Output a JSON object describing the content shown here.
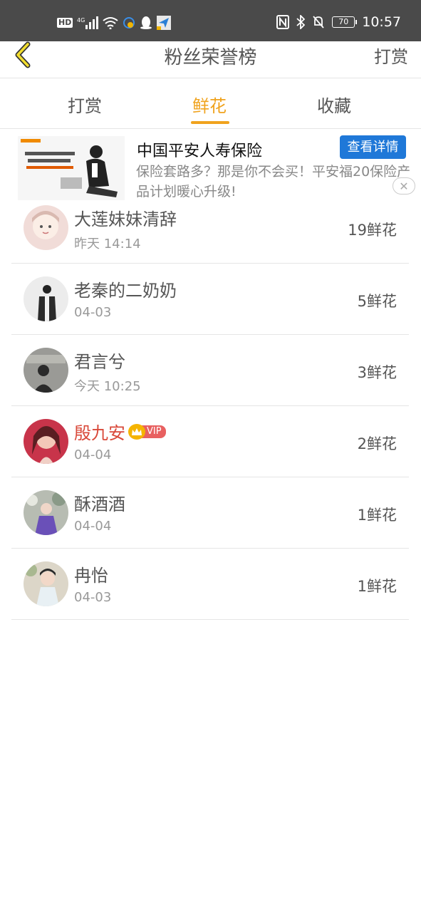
{
  "status_bar": {
    "hd_label": "HD",
    "network_label": "4G",
    "battery_level": "70",
    "time": "10:57"
  },
  "navbar": {
    "back_icon": "chevron-left-icon",
    "title": "粉丝荣誉榜",
    "right_action": "打赏"
  },
  "tabs": [
    {
      "label": "打赏",
      "active": false
    },
    {
      "label": "鲜花",
      "active": true
    },
    {
      "label": "收藏",
      "active": false
    }
  ],
  "ad": {
    "title": "中国平安人寿保险",
    "description": "保险套路多？那是你不会买！平安福20保险产品计划暖心升级!",
    "button_label": "查看详情",
    "close_icon": "close-icon"
  },
  "fans": [
    {
      "name": "大莲妹妹清辞",
      "date": "昨天 14:14",
      "count": "19鲜花",
      "vip": false
    },
    {
      "name": "老秦的二奶奶",
      "date": "04-03",
      "count": "5鲜花",
      "vip": false
    },
    {
      "name": "君言兮",
      "date": "今天 10:25",
      "count": "3鲜花",
      "vip": false
    },
    {
      "name": "殷九安",
      "date": "04-04",
      "count": "2鲜花",
      "vip": true,
      "vip_label": "VIP"
    },
    {
      "name": "酥酒酒",
      "date": "04-04",
      "count": "1鲜花",
      "vip": false
    },
    {
      "name": "冉怡",
      "date": "04-03",
      "count": "1鲜花",
      "vip": false
    }
  ],
  "colors": {
    "accent": "#f0a31e",
    "status_bar": "#4a4a4a",
    "vip_name": "#d9493a",
    "ad_button": "#1f78d8"
  }
}
